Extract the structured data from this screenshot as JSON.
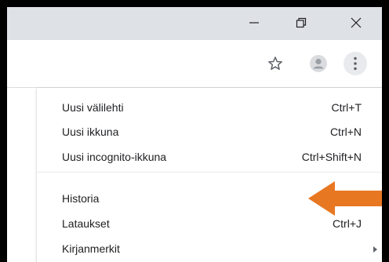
{
  "window": {
    "minimize_icon": "minimize-icon",
    "restore_icon": "restore-icon",
    "close_icon": "close-icon"
  },
  "toolbar": {
    "bookmark_icon": "star-icon",
    "profile_icon": "avatar-icon",
    "menu_icon": "kebab-menu-icon"
  },
  "menu": {
    "items": [
      {
        "label": "Uusi välilehti",
        "shortcut": "Ctrl+T"
      },
      {
        "label": "Uusi ikkuna",
        "shortcut": "Ctrl+N"
      },
      {
        "label": "Uusi incognito-ikkuna",
        "shortcut": "Ctrl+Shift+N"
      },
      {
        "label": "Historia",
        "shortcut": ""
      },
      {
        "label": "Lataukset",
        "shortcut": "Ctrl+J"
      },
      {
        "label": "Kirjanmerkit",
        "shortcut": ""
      }
    ]
  },
  "colors": {
    "titlebar": "#dee1e6",
    "highlight_arrow": "#e87722",
    "frame": "#000000"
  }
}
